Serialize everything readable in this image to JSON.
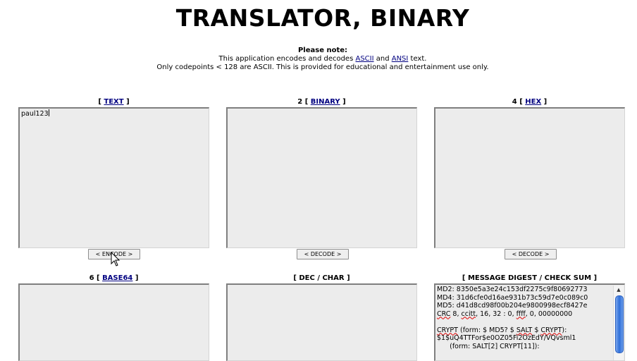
{
  "header": {
    "title": "TRANSLATOR, BINARY"
  },
  "note": {
    "heading": "Please note:",
    "line1_pre": "This application encodes and decodes ",
    "link_ascii": "ASCII",
    "line1_mid": " and ",
    "link_ansi": "ANSI",
    "line1_post": " text.",
    "line2": "Only codepoints < 128 are ASCII. This is provided for educational and entertainment use only."
  },
  "panels": {
    "text": {
      "label_pre": "[ ",
      "link": "TEXT",
      "label_post": " ]",
      "value": "paul123",
      "button": "< ENCODE >"
    },
    "binary": {
      "label_pre": "2 [ ",
      "link": "BINARY",
      "label_post": " ]",
      "value": "",
      "button": "< DECODE >"
    },
    "hex": {
      "label_pre": "4 [ ",
      "link": "HEX",
      "label_post": " ]",
      "value": "",
      "button": "< DECODE >"
    },
    "base64": {
      "label_pre": "6 [ ",
      "link": "BASE64",
      "label_post": " ]",
      "value": ""
    },
    "decchar": {
      "label": "[ DEC / CHAR ]",
      "value": ""
    },
    "digest": {
      "label": "[ MESSAGE DIGEST / CHECK SUM ]",
      "md2": "MD2: 8350e5a3e24c153df2275c9f80692773",
      "md4": "MD4: 31d6cfe0d16ae931b73c59d7e0c089c0",
      "md5": "MD5: d41d8cd98f00b204e9800998ecf8427e",
      "crc_label": "CRC",
      "crc_rest": " 8, ",
      "crc_ccitt": "ccitt",
      "crc_tail": ", 16, 32 : 0, ",
      "crc_ffff": "ffff",
      "crc_end": ", 0, 00000000",
      "crypt_label": "CRYPT",
      "crypt_rest": " (form: $ MD5? $ ",
      "crypt_salt": "SALT",
      "crypt_mid": " $ ",
      "crypt_crypt": "CRYPT",
      "crypt_end": "):",
      "crypt_value": "$1$uQ4TTFor$e0OZ05Fi2OzEdY/VQvsml1",
      "crypt_form2": "      (form: SALT[2] CRYPT[11]):"
    }
  }
}
